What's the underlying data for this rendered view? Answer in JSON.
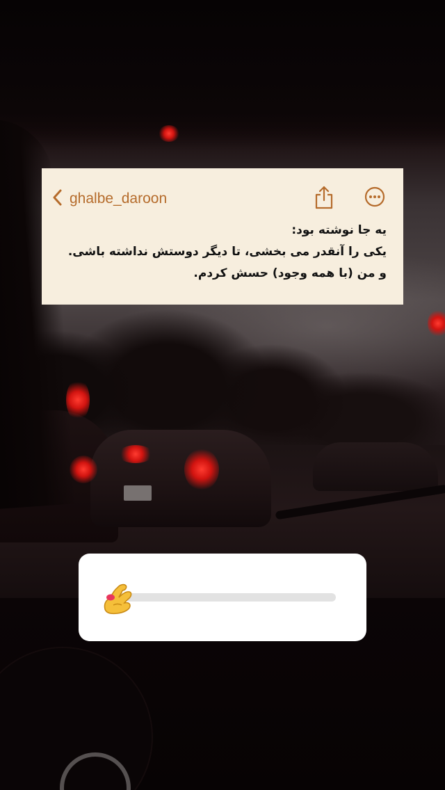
{
  "story": {
    "background_scene": "rainy-windshield-traffic-night"
  },
  "note_card": {
    "username": "ghalbe_daroon",
    "back_icon": "chevron-left-icon",
    "share_icon": "share-icon",
    "more_icon": "more-horizontal-icon",
    "accent_color": "#b56b2b",
    "background_color": "#f7eede",
    "lines": [
      "یه جا نوشته بود:",
      "یکی را آنقدر می بخشی، تا دیگر دوستش نداشته باشی.",
      "و من (با همه وجود) حسش کردم."
    ]
  },
  "emoji_slider": {
    "emoji": "🤌",
    "emoji_icon": "pinched-fingers-icon",
    "value": 0.0,
    "track_color": "#e2e2e2",
    "card_color": "#ffffff"
  }
}
